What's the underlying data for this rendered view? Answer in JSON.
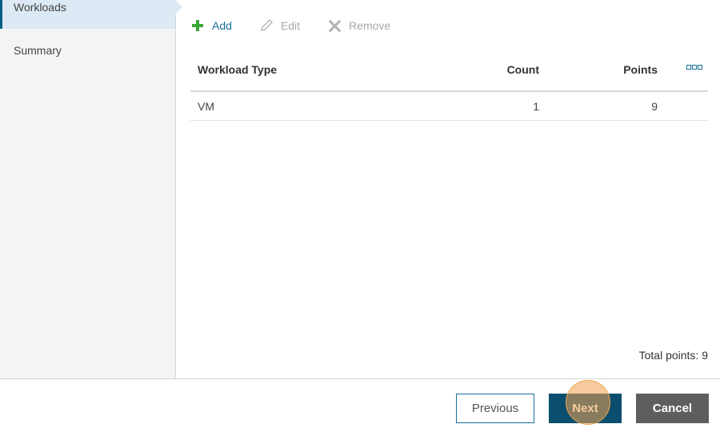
{
  "sidebar": {
    "items": [
      {
        "label": "Workloads",
        "active": true
      },
      {
        "label": "Summary",
        "active": false
      }
    ]
  },
  "toolbar": {
    "add_label": "Add",
    "edit_label": "Edit",
    "remove_label": "Remove"
  },
  "grid": {
    "columns": [
      "Workload Type",
      "Count",
      "Points"
    ],
    "rows": [
      {
        "type": "VM",
        "count": "1",
        "points": "9"
      }
    ],
    "menu_icon": "column-menu-icon"
  },
  "total_points": "Total points: 9",
  "footer": {
    "previous_label": "Previous",
    "next_label": "Next",
    "cancel_label": "Cancel"
  },
  "colors": {
    "accent": "#1a6e9a",
    "primary_button": "#0b4e6e",
    "cancel_button": "#5e5e5e",
    "add_icon": "#3aa63a",
    "sidebar_active": "#dde9f5",
    "cursor_highlight": "#f3a050"
  }
}
